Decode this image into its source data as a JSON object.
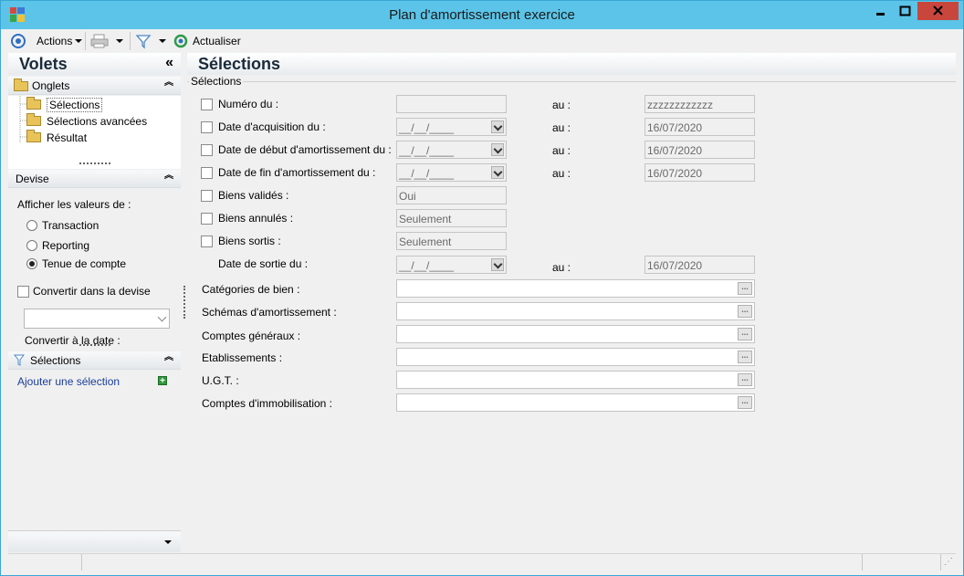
{
  "window": {
    "title": "Plan d'amortissement exercice"
  },
  "toolbar": {
    "actions_label": "Actions",
    "refresh_label": "Actualiser"
  },
  "panel": {
    "title": "Volets",
    "collapse_glyph": "«",
    "onglets": {
      "title": "Onglets",
      "items": [
        {
          "label": "Sélections"
        },
        {
          "label": "Sélections avancées"
        },
        {
          "label": "Résultat"
        }
      ]
    },
    "devise": {
      "title": "Devise",
      "afficher_label": "Afficher les valeurs de :",
      "options": [
        {
          "label": "Transaction",
          "selected": false
        },
        {
          "label": "Reporting",
          "selected": false
        },
        {
          "label": "Tenue de compte",
          "selected": true
        }
      ],
      "convertir_label": "Convertir dans la devise",
      "convertir_date_label": "Convertir à la date :"
    },
    "selections": {
      "title": "Sélections",
      "add_link": "Ajouter une sélection"
    }
  },
  "main": {
    "title": "Sélections",
    "group_label": "Sélections",
    "au_label": "au :",
    "rows": [
      {
        "label": "Numéro du :",
        "from": "",
        "to": "zzzzzzzzzzzz",
        "checkbox": true
      },
      {
        "label": "Date d'acquisition du :",
        "from": "__/__/____",
        "to": "16/07/2020",
        "checkbox": true
      },
      {
        "label": "Date de début d'amortissement du :",
        "from": "__/__/____",
        "to": "16/07/2020",
        "checkbox": true
      },
      {
        "label": "Date de fin d'amortissement du :",
        "from": "__/__/____",
        "to": "16/07/2020",
        "checkbox": true
      },
      {
        "label": "Biens validés :",
        "from": "Oui",
        "checkbox": true
      },
      {
        "label": "Biens annulés :",
        "from": "Seulement",
        "checkbox": true
      },
      {
        "label": "Biens sortis :",
        "from": "Seulement",
        "checkbox": true
      },
      {
        "label": "Date de sortie du :",
        "from": "__/__/____",
        "to": "16/07/2020",
        "checkbox": false
      }
    ],
    "lookups": [
      {
        "label": "Catégories de bien :",
        "value": ""
      },
      {
        "label": "Schémas d'amortissement :",
        "value": ""
      },
      {
        "label": "Comptes généraux :",
        "value": ""
      },
      {
        "label": "Etablissements :",
        "value": ""
      },
      {
        "label": "U.G.T. :",
        "value": ""
      },
      {
        "label": "Comptes d'immobilisation :",
        "value": ""
      }
    ],
    "ellipsis": "..."
  },
  "colors": {
    "titlebar": "#5bc4e8",
    "close": "#c9463d",
    "link": "#1a3d9a"
  }
}
